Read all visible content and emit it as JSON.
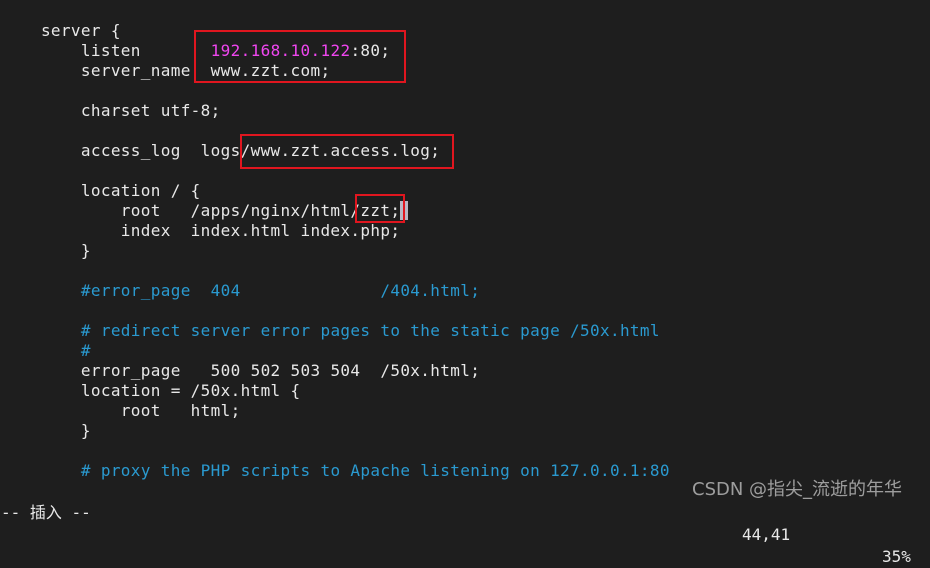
{
  "editor": {
    "lines": [
      {
        "indent": "    ",
        "text": "server {"
      },
      {
        "indent": "        ",
        "key": "listen",
        "pad": "       ",
        "ip": "192.168.10.122",
        "rest": ":80;"
      },
      {
        "indent": "        ",
        "text": "server_name  www.zzt.com;"
      },
      {
        "indent": "",
        "text": ""
      },
      {
        "indent": "        ",
        "text": "charset utf-8;"
      },
      {
        "indent": "",
        "text": ""
      },
      {
        "indent": "        ",
        "text": "access_log  logs/www.zzt.access.log;"
      },
      {
        "indent": "",
        "text": ""
      },
      {
        "indent": "        ",
        "text": "location / {"
      },
      {
        "indent": "            ",
        "text": "root   /apps/nginx/html/zzt;"
      },
      {
        "indent": "            ",
        "text": "index  index.html index.php;"
      },
      {
        "indent": "        ",
        "text": "}"
      },
      {
        "indent": "",
        "text": ""
      },
      {
        "indent": "        ",
        "comment": "#error_page  404              /404.html;"
      },
      {
        "indent": "",
        "text": ""
      },
      {
        "indent": "        ",
        "comment": "# redirect server error pages to the static page /50x.html"
      },
      {
        "indent": "        ",
        "comment": "#"
      },
      {
        "indent": "        ",
        "text": "error_page   500 502 503 504  /50x.html;"
      },
      {
        "indent": "        ",
        "text": "location = /50x.html {"
      },
      {
        "indent": "            ",
        "text": "root   html;"
      },
      {
        "indent": "        ",
        "text": "}"
      },
      {
        "indent": "",
        "text": ""
      },
      {
        "indent": "        ",
        "comment": "# proxy the PHP scripts to Apache listening on 127.0.0.1:80"
      }
    ]
  },
  "status": {
    "mode": "-- 插入 --",
    "position": "44,41",
    "percent": "35%"
  },
  "watermark": "CSDN @指尖_流逝的年华",
  "colors": {
    "background": "#1e1e1e",
    "text": "#e8e8e8",
    "ip_highlight": "#f046f0",
    "comment": "#2a9ad0",
    "annotation_box": "#e0161f"
  }
}
